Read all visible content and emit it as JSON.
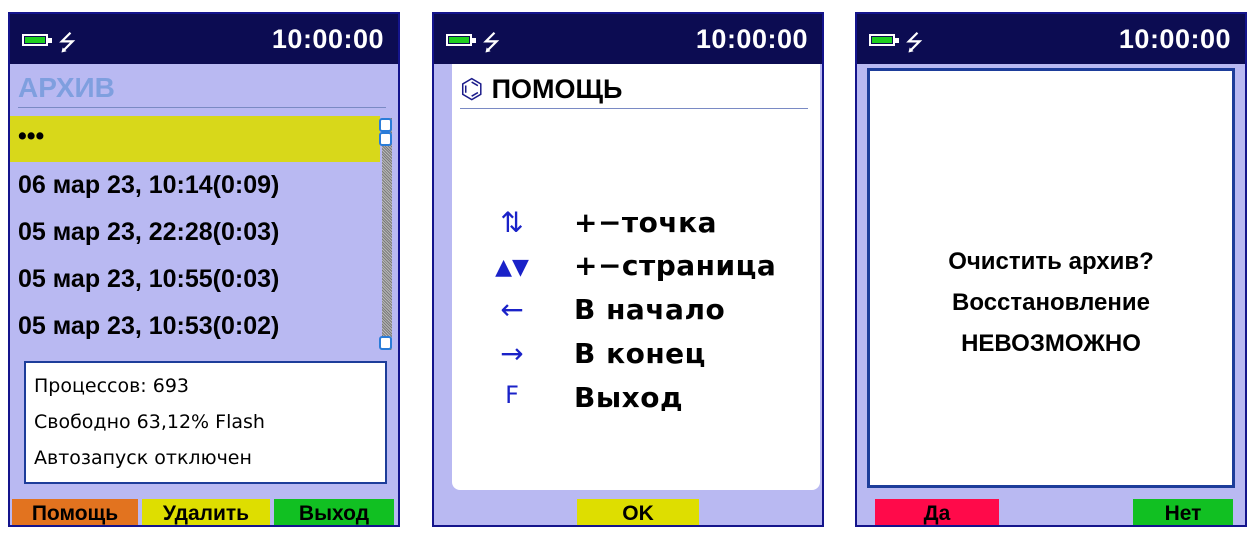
{
  "status": {
    "time": "10:00:00",
    "battery_icon": "battery-icon",
    "usb_icon": "usb-icon",
    "usb_glyph": "⭍"
  },
  "archive": {
    "title": "АРХИВ",
    "selected_label": "•••",
    "records": [
      "06 мар 23, 10:14(0:09)",
      "05 мар 23, 22:28(0:03)",
      "05 мар 23, 10:55(0:03)",
      "05 мар 23, 10:53(0:02)"
    ],
    "info": {
      "processes": "Процессов: 693",
      "free": "Свободно 63,12% Flash",
      "autostart": "Автозапуск отключен"
    },
    "buttons": {
      "help": "Помощь",
      "delete": "Удалить",
      "exit": "Выход"
    }
  },
  "help": {
    "title": "ПОМОЩЬ",
    "title_icon": "⌬",
    "items": [
      {
        "key": "⇅",
        "label": "+−точка"
      },
      {
        "key": "▲▼",
        "label": "+−страница"
      },
      {
        "key": "←",
        "label": "В начало"
      },
      {
        "key": "→",
        "label": "В конец"
      },
      {
        "key": "F",
        "label": "Выход"
      }
    ],
    "ok": "OK"
  },
  "confirm": {
    "line1": "Очистить архив?",
    "line2": "Восстановление",
    "line3": "НЕВОЗМОЖНО",
    "yes": "Да",
    "no": "Нет"
  },
  "colors": {
    "screen_bg": "#b9b9f2",
    "topbar": "#0c0c52",
    "selected_row": "#d8d81a",
    "help_button": "#e2731f",
    "delete_button": "#dede00",
    "exit_button": "#11c022",
    "yes_button": "#ff0a4a",
    "no_button": "#11c022"
  }
}
